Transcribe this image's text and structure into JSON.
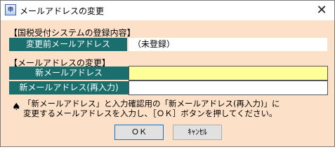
{
  "window": {
    "title": "メールアドレスの変更",
    "app_icon_text": "申"
  },
  "registration_section": {
    "heading": "【国税受付システムの登録内容】",
    "current_email_label": "変更前メールアドレス",
    "current_email_value": "（未登録）"
  },
  "change_section": {
    "heading": "【メールアドレスの変更】",
    "new_email_label": "新メールアドレス",
    "new_email_value": "",
    "confirm_email_label": "新メールアドレス(再入力)",
    "confirm_email_value": ""
  },
  "instructions": {
    "line1": "「新メールアドレス」と入力確認用の「新メールアドレス(再入力)」に",
    "line2": "変更するメールアドレスを入力し、［ＯＫ］ボタンを押してください。"
  },
  "buttons": {
    "ok_label": "ＯＫ",
    "cancel_label": "ｷｬﾝｾﾙ"
  },
  "colors": {
    "client_background": "#fde0c8",
    "label_background": "#1a6e6e",
    "required_input_background": "#ffff99"
  }
}
